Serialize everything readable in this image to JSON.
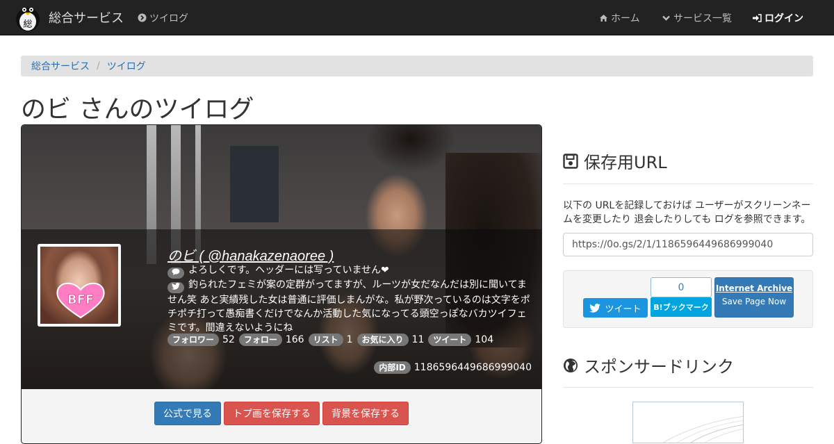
{
  "navbar": {
    "brand": "総合サービス",
    "brand_logo_char": "総",
    "twilog": "ツイログ",
    "home": "ホーム",
    "services": "サービス一覧",
    "login": "ログイン"
  },
  "breadcrumb": [
    "総合サービス",
    "ツイログ"
  ],
  "page_title": "のビ さんのツイログ",
  "profile": {
    "name": "のビ ( @hanakazenaoree )",
    "avatar_text": "BFF",
    "bio": "よろしくです。ヘッダーには写っていません❤",
    "description": "釣られたフェミが案の定群がってますが、ルーツが女だなんだは別に聞いてません笑 あと実績残した女は普通に評価しまんがな。私が野次っているのは文字をポチポチ打って愚痴書くだけでなんか活動した気になってる頭空っぽなバカツイフェミです。間違えないようにね",
    "stats": [
      {
        "label": "フォロワー",
        "value": "52"
      },
      {
        "label": "フォロー",
        "value": "166"
      },
      {
        "label": "リスト",
        "value": "1"
      },
      {
        "label": "お気に入り",
        "value": "11"
      },
      {
        "label": "ツイート",
        "value": "104"
      }
    ],
    "internal_id_label": "内部ID",
    "internal_id": "1186596449686999040"
  },
  "buttons": {
    "official": "公式で見る",
    "save_top": "トプ画を保存する",
    "save_bg": "背景を保存する"
  },
  "save": {
    "heading": "保存用URL",
    "description": "以下の URLを記録しておけば ユーザーがスクリーンネームを変更したり 退会したりしても ログを参照できます。",
    "url": "https://0o.gs/2/1/1186596449686999040"
  },
  "share": {
    "tweet": "ツイート",
    "hatena_count": "0",
    "hatena": "B!ブックマーク",
    "archive_title": "Internet Archive",
    "archive_sub": "Save Page Now"
  },
  "sponsor": {
    "heading": "スポンサードリンク"
  },
  "colors": {
    "navbar_bg": "#222222",
    "link": "#2a6fb5",
    "primary": "#337ab7",
    "danger": "#d9534f",
    "twitter": "#1b95e0",
    "hatena": "#00a4de"
  }
}
